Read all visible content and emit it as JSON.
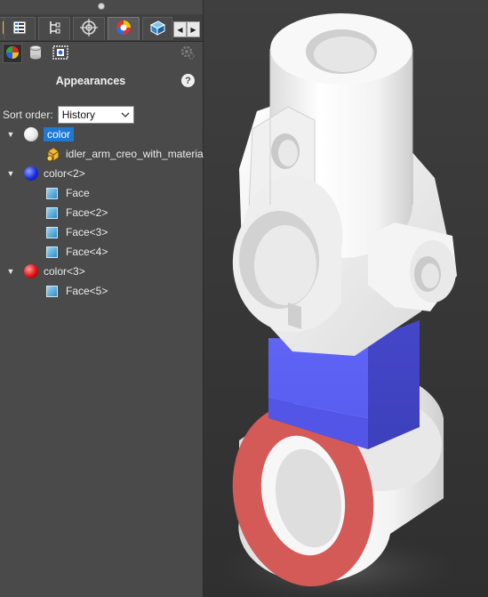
{
  "panel": {
    "title": "Appearances",
    "help_glyph": "?",
    "tabs": [
      {
        "icon": "feature-tree-icon",
        "active": false
      },
      {
        "icon": "property-tree-icon",
        "active": false
      },
      {
        "icon": "target-icon",
        "active": false
      },
      {
        "icon": "appearance-ball-icon",
        "active": true
      },
      {
        "icon": "display-pane-icon",
        "active": false
      }
    ],
    "subtoolbar": [
      {
        "icon": "color-wheel-icon",
        "active": true
      },
      {
        "icon": "database-icon",
        "active": false
      },
      {
        "icon": "scene-icon",
        "active": false
      }
    ],
    "sort_order": {
      "label": "Sort order:",
      "value": "History"
    }
  },
  "tree": [
    {
      "kind": "color",
      "label": "color",
      "ball": "#ffffff",
      "expanded": true,
      "selected": true,
      "children": [
        {
          "kind": "material",
          "label": "idler_arm_creo_with_material"
        }
      ]
    },
    {
      "kind": "color",
      "label": "color<2>",
      "ball": "#1a2be0",
      "expanded": true,
      "selected": false,
      "children": [
        {
          "kind": "face",
          "label": "Face"
        },
        {
          "kind": "face",
          "label": "Face<2>"
        },
        {
          "kind": "face",
          "label": "Face<3>"
        },
        {
          "kind": "face",
          "label": "Face<4>"
        }
      ]
    },
    {
      "kind": "color",
      "label": "color<3>",
      "ball": "#e01010",
      "expanded": true,
      "selected": false,
      "children": [
        {
          "kind": "face",
          "label": "Face<5>"
        }
      ]
    }
  ],
  "colors": {
    "part_white": "#f2f2f2",
    "part_blue": "#5a5ef0",
    "part_red": "#d45a57",
    "selection": "#1f78d1"
  }
}
